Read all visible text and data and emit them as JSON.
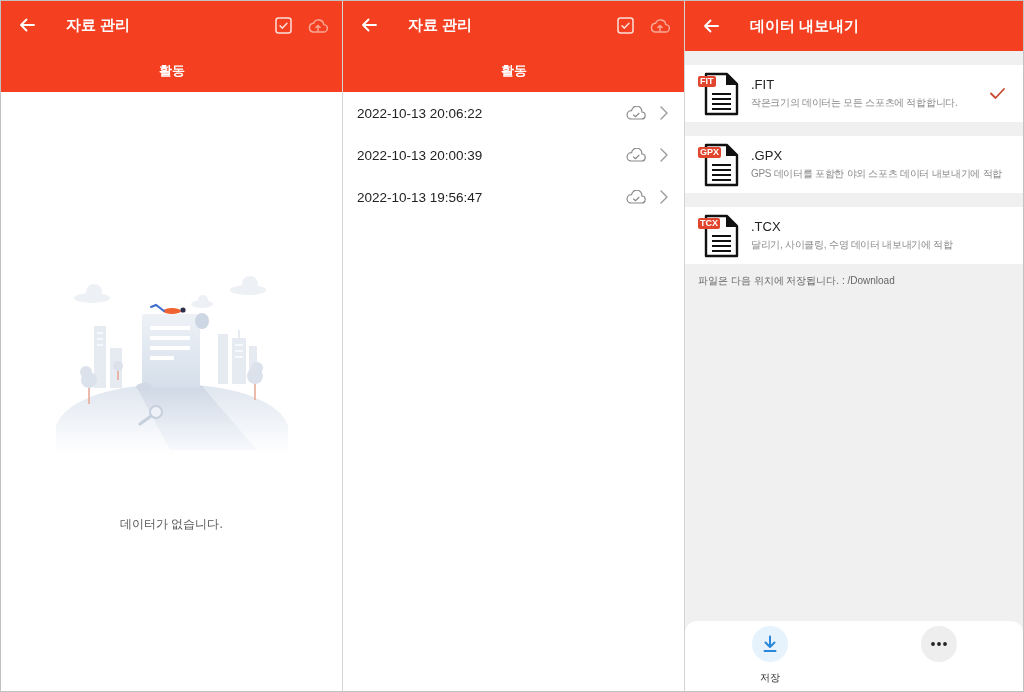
{
  "screens": [
    {
      "kind": "activity",
      "title": "자료 관리",
      "tabs": [
        {
          "label": "활동",
          "selected": true
        }
      ],
      "empty_message": "데이터가 없습니다."
    },
    {
      "kind": "activity",
      "title": "자료 관리",
      "tabs": [
        {
          "label": "활동",
          "selected": true
        }
      ],
      "records": [
        "2022-10-13 20:06:22",
        "2022-10-13 20:00:39",
        "2022-10-13 19:56:47"
      ]
    },
    {
      "kind": "export",
      "title": "데이터 내보내기",
      "formats": [
        {
          "badge": "FIT",
          "name": ".FIT",
          "description": "작은크기의 데이터는 모든 스포츠에 적합합니다.",
          "selected": true
        },
        {
          "badge": "GPX",
          "name": ".GPX",
          "description": "GPS 데이터를 포함한 야외 스포츠 데이터 내보내기에 적합",
          "selected": false
        },
        {
          "badge": "TCX",
          "name": ".TCX",
          "description": "달리기, 사이클링, 수영 데이터 내보내기에 적합",
          "selected": false
        }
      ],
      "save_location": "파일은 다음 위치에 저장됩니다. : /Download",
      "actions": [
        {
          "kind": "download",
          "label": "저장"
        },
        {
          "kind": "more"
        }
      ]
    }
  ]
}
